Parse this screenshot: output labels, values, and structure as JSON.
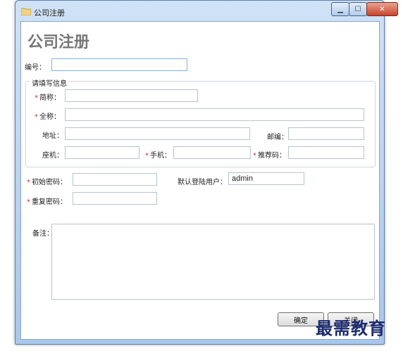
{
  "window": {
    "title": "公司注册"
  },
  "form": {
    "heading": "公司注册",
    "number_label": "编号：",
    "group_title": "请填写信息",
    "short_name_label": "简称：",
    "full_name_label": "全称：",
    "address_label": "地址：",
    "zip_label": "邮编：",
    "phone_label": "座机：",
    "mobile_label": "手机：",
    "referral_label": "推荐码：",
    "initial_password_label": "初始密码：",
    "default_user_label": "默认登陆用户：",
    "default_user_value": "admin",
    "repeat_password_label": "重复密码：",
    "remarks_label": "备注：",
    "required_mark": "*"
  },
  "buttons": {
    "confirm": "确定",
    "close": "关闭"
  },
  "watermark": "最需教育",
  "icons": {
    "window_icon": "folder-icon",
    "minimize": "minimize-icon",
    "maximize": "maximize-icon",
    "close": "close-icon"
  }
}
